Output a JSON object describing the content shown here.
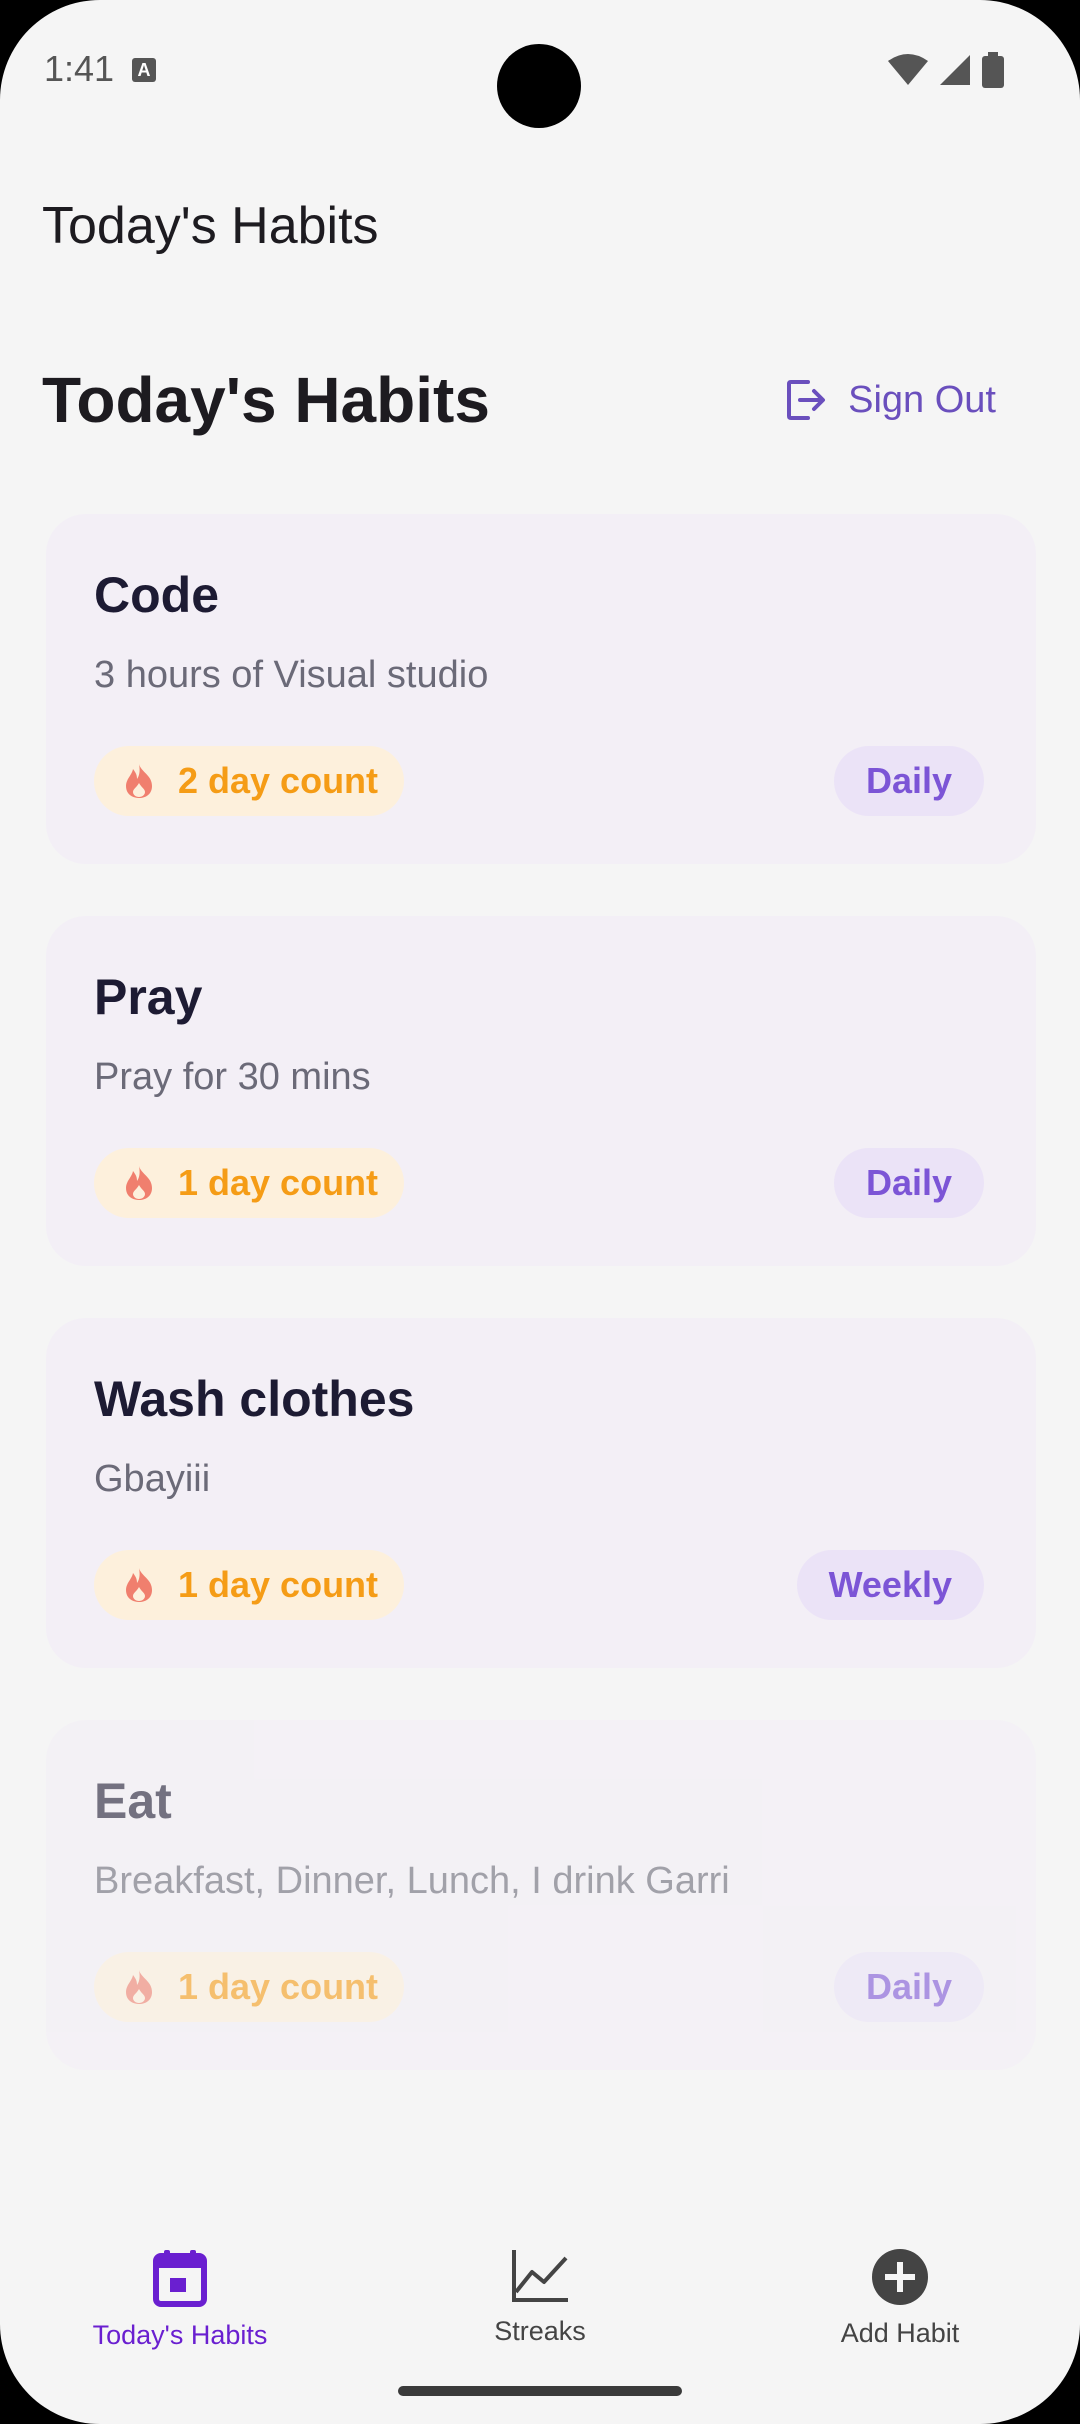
{
  "status_bar": {
    "time": "1:41",
    "notif_glyph": "A"
  },
  "app_bar": {
    "title": "Today's Habits"
  },
  "header": {
    "heading": "Today's Habits",
    "sign_out_label": "Sign Out"
  },
  "habits": [
    {
      "title": "Code",
      "description": "3 hours of Visual studio",
      "streak": "2 day count",
      "frequency": "Daily",
      "completed": false
    },
    {
      "title": "Pray",
      "description": "Pray for 30 mins",
      "streak": "1 day count",
      "frequency": "Daily",
      "completed": false
    },
    {
      "title": "Wash clothes",
      "description": "Gbayiii",
      "streak": "1 day count",
      "frequency": "Weekly",
      "completed": false
    },
    {
      "title": "Eat",
      "description": "Breakfast, Dinner, Lunch, I drink Garri",
      "streak": "1 day count",
      "frequency": "Daily",
      "completed": true
    }
  ],
  "bottom_nav": {
    "items": [
      {
        "label": "Today's Habits",
        "icon": "calendar-icon",
        "active": true
      },
      {
        "label": "Streaks",
        "icon": "chart-line-icon",
        "active": false
      },
      {
        "label": "Add Habit",
        "icon": "add-circle-icon",
        "active": false
      }
    ]
  },
  "colors": {
    "accent": "#6a1fd0",
    "streak_text": "#f59c16",
    "streak_bg": "#fdf0dc",
    "frequency_text": "#7c55d6",
    "frequency_bg": "#ebe3f7",
    "card_bg": "#f3eff6"
  }
}
